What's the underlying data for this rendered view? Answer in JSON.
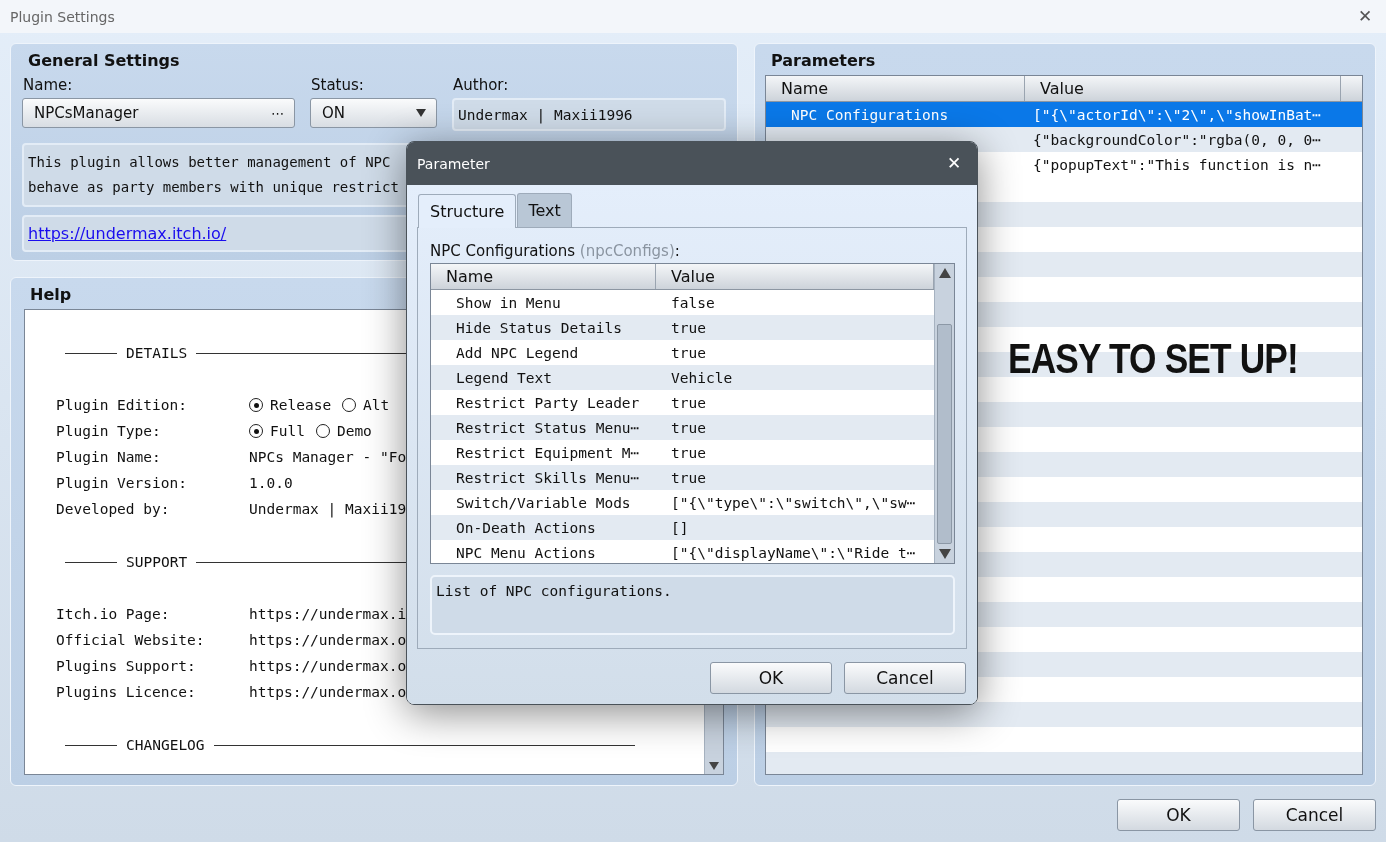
{
  "window": {
    "title": "Plugin Settings",
    "close": "✕"
  },
  "general": {
    "title": "General Settings",
    "name_label": "Name:",
    "name": "NPCsManager",
    "name_button": "⋯",
    "status_label": "Status:",
    "status": "ON",
    "author_label": "Author:",
    "author": "Undermax | Maxii1996",
    "description": [
      "This plugin allows better management of NPC",
      "behave as party members with unique restrict"
    ],
    "url": "https://undermax.itch.io/"
  },
  "help": {
    "title": "Help",
    "blocks": [
      {
        "kind": "heading",
        "text": "DETAILS"
      },
      {
        "kind": "radio",
        "label": "Plugin Edition:",
        "options": [
          {
            "label": "Release",
            "selected": true
          },
          {
            "label": "Alt",
            "selected": false
          }
        ]
      },
      {
        "kind": "radio",
        "label": "Plugin Type:",
        "options": [
          {
            "label": "Full",
            "selected": true
          },
          {
            "label": "Demo",
            "selected": false
          }
        ]
      },
      {
        "kind": "row",
        "label": "Plugin Name:",
        "value": "NPCs Manager - \"Fo"
      },
      {
        "kind": "row",
        "label": "Plugin Version:",
        "value": "1.0.0"
      },
      {
        "kind": "row",
        "label": "Developed by:",
        "value": "Undermax | Maxii19"
      },
      {
        "kind": "heading",
        "text": "SUPPORT"
      },
      {
        "kind": "row",
        "label": "Itch.io Page:",
        "value": "https://undermax.i"
      },
      {
        "kind": "row",
        "label": "Official Website:",
        "value": "https://undermax.o"
      },
      {
        "kind": "row",
        "label": "Plugins Support:",
        "value": "https://undermax.o"
      },
      {
        "kind": "row",
        "label": "Plugins Licence:",
        "value": "https://undermax.o"
      },
      {
        "kind": "heading",
        "text": "CHANGELOG"
      }
    ]
  },
  "parameters": {
    "title": "Parameters",
    "columns": [
      "Name",
      "Value"
    ],
    "rows": [
      {
        "name": "NPC Configurations",
        "value": "[\"{\\\"actorId\\\":\\\"2\\\",\\\"showInBat⋯",
        "selected": true
      },
      {
        "value": "{\"backgroundColor\":\"rgba(0, 0, 0⋯",
        "selected": false
      },
      {
        "value": "{\"popupText\":\"This function is n⋯",
        "selected": false
      }
    ]
  },
  "overlay_text": "EASY TO SET UP!",
  "buttons": [
    "OK",
    "Cancel"
  ],
  "dialog": {
    "title": "Parameter",
    "close": "✕",
    "tabs": [
      {
        "label": "Structure",
        "selected": true
      },
      {
        "label": "Text",
        "selected": false
      }
    ],
    "field_name": "NPC Configurations",
    "field_key": "(npcConfigs)",
    "field_suffix": ":",
    "columns": [
      "Name",
      "Value"
    ],
    "rows": [
      {
        "name": "Show in Menu",
        "value": "false"
      },
      {
        "name": "Hide Status Details",
        "value": "true"
      },
      {
        "name": "Add NPC Legend",
        "value": "true"
      },
      {
        "name": "Legend Text",
        "value": "Vehicle"
      },
      {
        "name": "Restrict Party Leader",
        "value": "true"
      },
      {
        "name": "Restrict Status Menu⋯",
        "value": "true"
      },
      {
        "name": "Restrict Equipment M⋯",
        "value": "true"
      },
      {
        "name": "Restrict Skills Menu⋯",
        "value": "true"
      },
      {
        "name": "Switch/Variable Mods",
        "value": "[\"{\\\"type\\\":\\\"switch\\\",\\\"sw⋯"
      },
      {
        "name": "On-Death Actions",
        "value": "[]"
      },
      {
        "name": "NPC Menu Actions",
        "value": "[\"{\\\"displayName\\\":\\\"Ride t⋯"
      }
    ],
    "description": "List of NPC configurations.",
    "buttons": [
      "OK",
      "Cancel"
    ]
  }
}
